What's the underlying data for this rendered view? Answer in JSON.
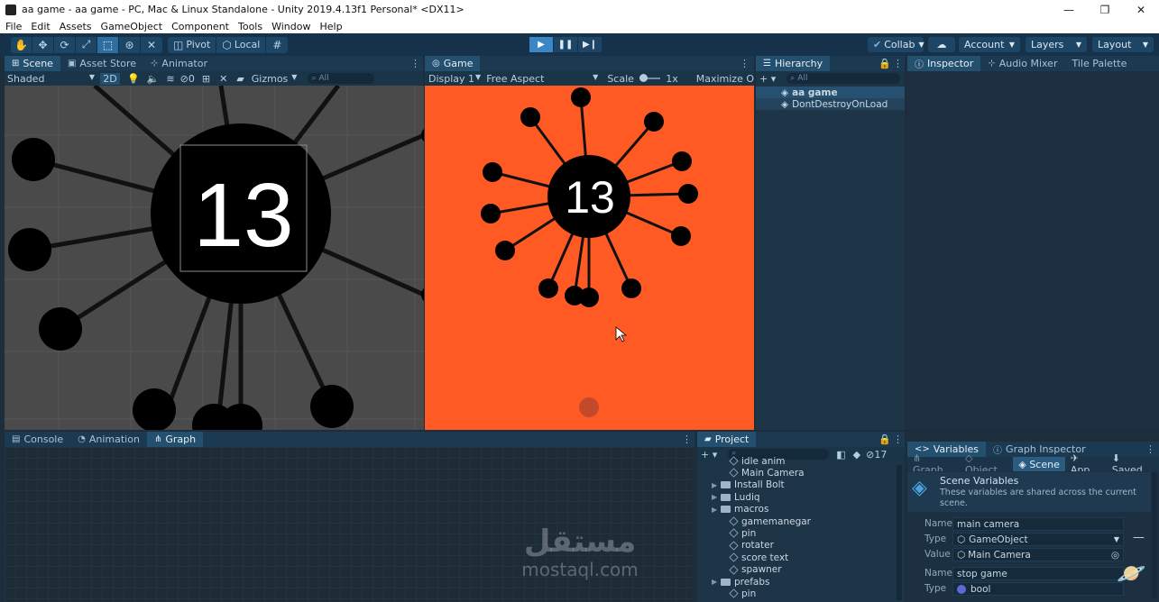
{
  "window": {
    "title": "aa game - aa game - PC, Mac & Linux Standalone - Unity 2019.4.13f1 Personal* <DX11>",
    "min": "—",
    "max": "❐",
    "close": "✕"
  },
  "menu": [
    "File",
    "Edit",
    "Assets",
    "GameObject",
    "Component",
    "Tools",
    "Window",
    "Help"
  ],
  "toolbar": {
    "pivot": "Pivot",
    "local": "Local",
    "collab": "Collab",
    "account": "Account",
    "layers": "Layers",
    "layout": "Layout"
  },
  "scene_panel": {
    "tabs": [
      "Scene",
      "Asset Store",
      "Animator"
    ],
    "shading": "Shaded",
    "mode_2d": "2D",
    "hidden_count": "0",
    "gizmos": "Gizmos",
    "search_placeholder": "All",
    "counter": "13"
  },
  "game_panel": {
    "tab": "Game",
    "display": "Display 1",
    "aspect": "Free Aspect",
    "scale_label": "Scale",
    "scale_value": "1x",
    "maximize": "Maximize O",
    "counter": "13",
    "background": "#ff5a24"
  },
  "hierarchy": {
    "tab": "Hierarchy",
    "search_placeholder": "All",
    "items": [
      "aa game",
      "DontDestroyOnLoad"
    ]
  },
  "inspector": {
    "tabs": [
      "Inspector",
      "Audio Mixer",
      "Tile Palette"
    ]
  },
  "bottom_left": {
    "tabs": [
      "Console",
      "Animation",
      "Graph"
    ]
  },
  "project": {
    "tab": "Project",
    "hidden_count": "17",
    "items": [
      {
        "label": "idle anim",
        "type": "asset",
        "indent": 2
      },
      {
        "label": "Main Camera",
        "type": "asset",
        "indent": 2
      },
      {
        "label": "Install Bolt",
        "type": "folder",
        "indent": 1
      },
      {
        "label": "Ludiq",
        "type": "folder",
        "indent": 1
      },
      {
        "label": "macros",
        "type": "folder",
        "indent": 1
      },
      {
        "label": "gamemanegar",
        "type": "asset",
        "indent": 2
      },
      {
        "label": "pin",
        "type": "asset",
        "indent": 2
      },
      {
        "label": "rotater",
        "type": "asset",
        "indent": 2
      },
      {
        "label": "score text",
        "type": "asset",
        "indent": 2
      },
      {
        "label": "spawner",
        "type": "asset",
        "indent": 2
      },
      {
        "label": "prefabs",
        "type": "folder",
        "indent": 1
      },
      {
        "label": "pin",
        "type": "asset",
        "indent": 2
      }
    ]
  },
  "variables": {
    "tabs": [
      "Variables",
      "Graph Inspector"
    ],
    "scopes": [
      "Graph",
      "Object",
      "Scene",
      "App",
      "Saved"
    ],
    "heading": "Scene Variables",
    "description": "These variables are shared across the current scene.",
    "entries": [
      {
        "name_label": "Name",
        "name": "main camera",
        "type_label": "Type",
        "type": "GameObject",
        "value_label": "Value",
        "value": "Main Camera"
      },
      {
        "name_label": "Name",
        "name": "stop game",
        "type_label": "Type",
        "type": "bool"
      }
    ]
  },
  "watermark": {
    "arabic": "مستقل",
    "latin": "mostaql.com"
  },
  "colors": {
    "panel_bg": "#1e2d3b",
    "tab_bg": "#1b3a52",
    "accent": "#3b86c6",
    "game_bg": "#ff5a24",
    "scene_bg": "#4a4a4a"
  }
}
